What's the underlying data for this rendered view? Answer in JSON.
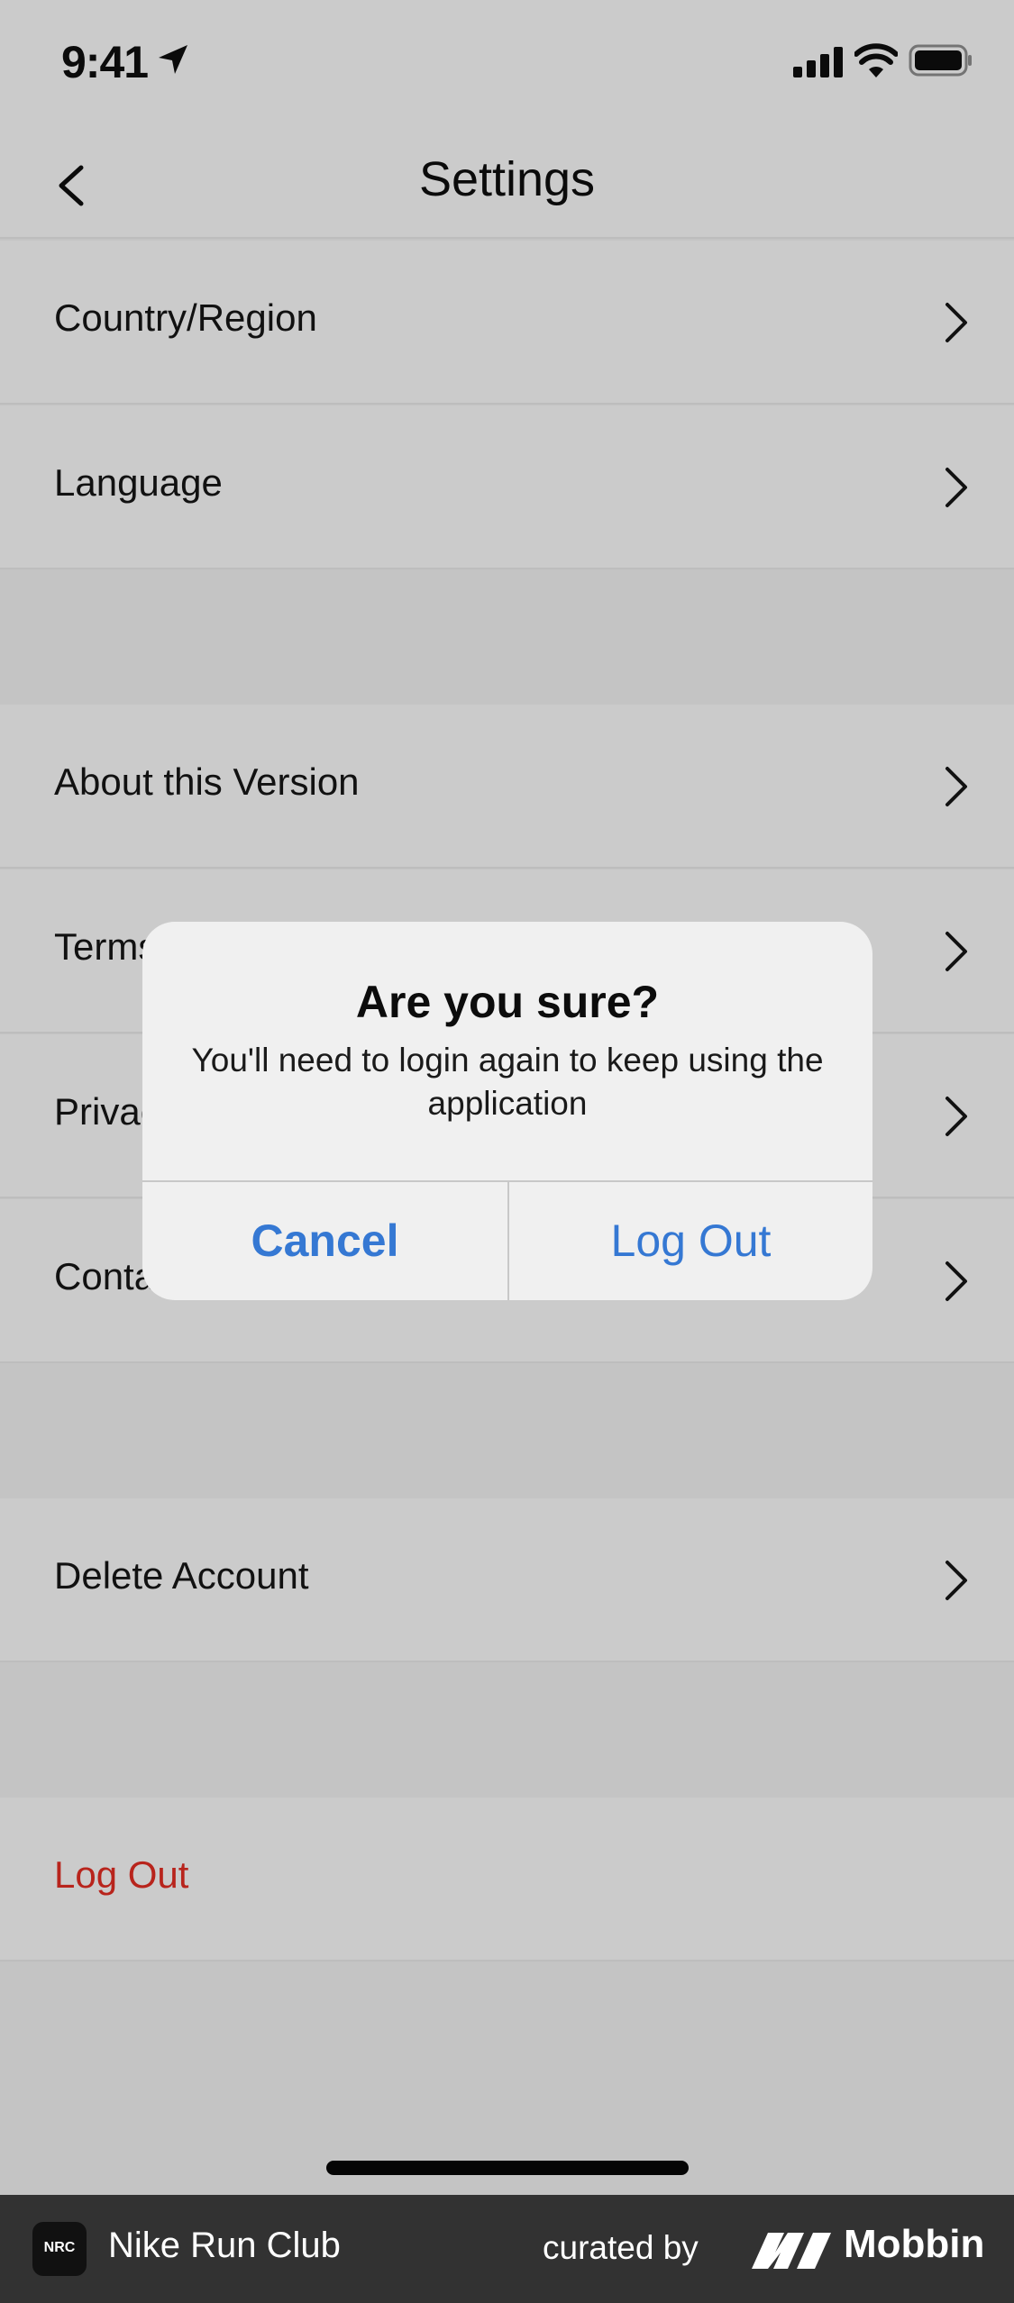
{
  "status_bar": {
    "time": "9:41"
  },
  "nav": {
    "title": "Settings"
  },
  "rows": {
    "country": "Country/Region",
    "language": "Language",
    "about": "About this Version",
    "terms": "Terms",
    "privacy": "Privac",
    "contact": "Conta",
    "delete": "Delete Account",
    "logout": "Log Out"
  },
  "dialog": {
    "title": "Are you sure?",
    "message": "You'll need to login again to keep using the application",
    "cancel_label": "Cancel",
    "confirm_label": "Log Out"
  },
  "banner": {
    "logo_text": "NRC",
    "app_name": "Nike Run Club",
    "curated_by": "curated by",
    "brand": "Mobbin"
  },
  "colors": {
    "accent_blue": "#3578d3",
    "destructive_red": "#b8241c",
    "row_background": "#cbcbcb",
    "dialog_background": "#f0f0f0"
  },
  "icons": [
    "location-arrow-icon",
    "signal-icon",
    "wifi-icon",
    "battery-icon",
    "back-chevron-icon",
    "chevron-right-icon",
    "mobbin-logo-icon"
  ]
}
